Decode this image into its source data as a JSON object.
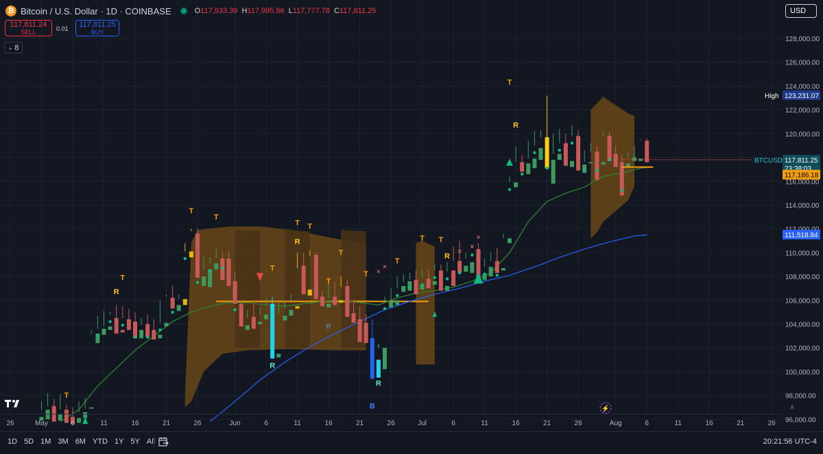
{
  "header": {
    "title": "Bitcoin / U.S. Dollar · 1D · COINBASE",
    "ohlc": [
      {
        "k": "O",
        "v": "117,933.39"
      },
      {
        "k": "H",
        "v": "117,995.86"
      },
      {
        "k": "L",
        "v": "117,777.78"
      },
      {
        "k": "C",
        "v": "117,811.25"
      }
    ]
  },
  "trade": {
    "sell_price": "117,811.24",
    "sell_label": "SELL",
    "buy_price": "117,811.25",
    "buy_label": "BUY",
    "spread": "0.01"
  },
  "indicator_badge": "8",
  "currency": "USD",
  "timeframes": [
    "1D",
    "5D",
    "1M",
    "3M",
    "6M",
    "YTD",
    "1Y",
    "5Y",
    "All"
  ],
  "clock": "20:21:56 UTC-4",
  "colors": {
    "up": "#26a69a",
    "down": "#ef5350",
    "up_wick": "#4caf50",
    "signal_up": "#facc15",
    "signal_down": "#f97316",
    "cloud": "#8a5a12",
    "ma_green": "#2e7d32",
    "ma_blue": "#2962ff",
    "dots": "#00e676"
  },
  "chart_data": {
    "type": "candlestick",
    "title": "Bitcoin / U.S. Dollar · 1D · COINBASE",
    "xlabel": "",
    "ylabel": "",
    "ylim": [
      95500,
      129500
    ],
    "y_ticks": [
      96000,
      98000,
      100000,
      102000,
      104000,
      106000,
      108000,
      110000,
      112000,
      114000,
      116000,
      118000,
      120000,
      122000,
      124000,
      126000,
      128000
    ],
    "x_ticks": [
      {
        "label": "26",
        "day": 0
      },
      {
        "label": "May",
        "day": 5
      },
      {
        "label": "6",
        "day": 10
      },
      {
        "label": "11",
        "day": 15
      },
      {
        "label": "16",
        "day": 20
      },
      {
        "label": "21",
        "day": 25
      },
      {
        "label": "26",
        "day": 30
      },
      {
        "label": "Jun",
        "day": 36
      },
      {
        "label": "6",
        "day": 41
      },
      {
        "label": "11",
        "day": 46
      },
      {
        "label": "16",
        "day": 51
      },
      {
        "label": "21",
        "day": 56
      },
      {
        "label": "26",
        "day": 61
      },
      {
        "label": "Jul",
        "day": 66
      },
      {
        "label": "6",
        "day": 71
      },
      {
        "label": "11",
        "day": 76
      },
      {
        "label": "16",
        "day": 81
      },
      {
        "label": "21",
        "day": 86
      },
      {
        "label": "26",
        "day": 91
      },
      {
        "label": "Aug",
        "day": 97
      },
      {
        "label": "6",
        "day": 102
      },
      {
        "label": "11",
        "day": 107
      },
      {
        "label": "16",
        "day": 112
      },
      {
        "label": "21",
        "day": 117
      },
      {
        "label": "26",
        "day": 122
      }
    ],
    "candles": [
      [
        5,
        96200,
        97500,
        96800,
        95900,
        "u"
      ],
      [
        6,
        96800,
        98200,
        97100,
        96000,
        "u"
      ],
      [
        7,
        97100,
        97700,
        96400,
        95800,
        "d"
      ],
      [
        8,
        96400,
        98100,
        96800,
        95900,
        "u"
      ],
      [
        9,
        96800,
        97200,
        96200,
        95700,
        "d"
      ],
      [
        10,
        96200,
        97000,
        96100,
        95600,
        "d"
      ],
      [
        11,
        96100,
        97500,
        96600,
        95700,
        "u"
      ],
      [
        12,
        96600,
        97800,
        96900,
        96100,
        "u"
      ],
      [
        13,
        97000,
        103500,
        103200,
        96900,
        "u"
      ],
      [
        14,
        103200,
        104700,
        103600,
        102400,
        "u"
      ],
      [
        15,
        103600,
        105100,
        103800,
        103100,
        "u"
      ],
      [
        16,
        103800,
        105000,
        104800,
        103500,
        "u"
      ],
      [
        17,
        104500,
        105600,
        103500,
        103200,
        "d"
      ],
      [
        18,
        103500,
        105500,
        104500,
        103300,
        "d"
      ],
      [
        19,
        104400,
        105300,
        104000,
        103500,
        "d"
      ],
      [
        20,
        104200,
        105000,
        103500,
        102800,
        "d"
      ],
      [
        21,
        103500,
        104500,
        103900,
        102800,
        "u"
      ],
      [
        22,
        104000,
        104800,
        103500,
        102900,
        "d"
      ],
      [
        23,
        103500,
        104400,
        103100,
        102700,
        "d"
      ],
      [
        24,
        103100,
        106000,
        104100,
        102800,
        "u"
      ],
      [
        25,
        104100,
        106500,
        106300,
        103800,
        "u"
      ],
      [
        26,
        106200,
        107200,
        105600,
        105300,
        "d"
      ],
      [
        27,
        105600,
        106500,
        106100,
        105100,
        "u"
      ],
      [
        28,
        106100,
        110800,
        110100,
        105600,
        "u"
      ],
      [
        29,
        110100,
        112000,
        111800,
        109600,
        "u"
      ],
      [
        30,
        111600,
        112000,
        108100,
        107900,
        "d"
      ],
      [
        31,
        108000,
        109700,
        108600,
        107200,
        "u"
      ],
      [
        32,
        108600,
        109600,
        109100,
        107100,
        "u"
      ],
      [
        33,
        109100,
        110400,
        109600,
        108600,
        "u"
      ],
      [
        34,
        109500,
        110100,
        109300,
        107700,
        "d"
      ],
      [
        35,
        109500,
        110100,
        107500,
        107200,
        "d"
      ],
      [
        36,
        107600,
        108400,
        105800,
        105700,
        "d"
      ],
      [
        37,
        105700,
        105900,
        104000,
        103800,
        "d"
      ],
      [
        38,
        103900,
        105200,
        104500,
        103500,
        "u"
      ],
      [
        39,
        104600,
        105700,
        104200,
        103600,
        "d"
      ],
      [
        40,
        104200,
        105400,
        104800,
        104000,
        "u"
      ],
      [
        41,
        104800,
        106200,
        105600,
        104400,
        "u"
      ],
      [
        42,
        105700,
        106300,
        101300,
        101100,
        "d"
      ],
      [
        43,
        101500,
        105800,
        104900,
        101200,
        "u"
      ],
      [
        44,
        104700,
        106000,
        105300,
        104300,
        "u"
      ],
      [
        45,
        105200,
        106500,
        105800,
        104700,
        "u"
      ],
      [
        46,
        105500,
        110000,
        108700,
        105300,
        "u"
      ],
      [
        47,
        108900,
        110000,
        106900,
        106500,
        "d"
      ],
      [
        48,
        106900,
        110200,
        109700,
        106400,
        "u"
      ],
      [
        49,
        109800,
        110000,
        106300,
        106100,
        "d"
      ],
      [
        50,
        106300,
        106800,
        105700,
        105500,
        "d"
      ],
      [
        51,
        105700,
        107400,
        106200,
        105400,
        "u"
      ],
      [
        52,
        106300,
        107500,
        105800,
        105600,
        "d"
      ],
      [
        53,
        106000,
        108000,
        107100,
        105800,
        "u"
      ],
      [
        54,
        107200,
        107700,
        104800,
        104600,
        "d"
      ],
      [
        55,
        104900,
        106000,
        104300,
        104100,
        "d"
      ],
      [
        56,
        104400,
        105500,
        104000,
        102500,
        "d"
      ],
      [
        57,
        104100,
        104800,
        102700,
        102400,
        "d"
      ],
      [
        58,
        102800,
        104400,
        101000,
        99400,
        "d"
      ],
      [
        59,
        101000,
        102300,
        102000,
        99500,
        "u"
      ],
      [
        60,
        102000,
        106300,
        105900,
        100200,
        "u"
      ],
      [
        61,
        105900,
        107000,
        106000,
        105400,
        "u"
      ],
      [
        62,
        106000,
        108000,
        107000,
        105600,
        "u"
      ],
      [
        63,
        107200,
        108200,
        107500,
        106700,
        "u"
      ],
      [
        64,
        107600,
        108300,
        107700,
        106800,
        "u"
      ],
      [
        65,
        107700,
        108500,
        107300,
        106500,
        "d"
      ],
      [
        66,
        107300,
        108600,
        107900,
        106900,
        "u"
      ],
      [
        67,
        107800,
        108600,
        107600,
        107000,
        "d"
      ],
      [
        68,
        107600,
        109000,
        108500,
        107300,
        "u"
      ],
      [
        69,
        108500,
        109000,
        107200,
        106800,
        "d"
      ],
      [
        70,
        107200,
        109200,
        108400,
        106800,
        "u"
      ],
      [
        71,
        108500,
        110500,
        109300,
        107200,
        "d"
      ],
      [
        72,
        109300,
        111000,
        108900,
        108300,
        "d"
      ],
      [
        73,
        108900,
        110000,
        109500,
        108400,
        "u"
      ],
      [
        74,
        109200,
        110500,
        110400,
        108300,
        "u"
      ],
      [
        75,
        110300,
        110800,
        108200,
        107900,
        "d"
      ],
      [
        76,
        108200,
        109500,
        108800,
        107700,
        "u"
      ],
      [
        77,
        108800,
        110000,
        109300,
        108000,
        "u"
      ],
      [
        78,
        109300,
        110400,
        108700,
        108300,
        "d"
      ],
      [
        79,
        108700,
        111600,
        111200,
        108500,
        "u"
      ],
      [
        80,
        111200,
        116400,
        115900,
        110800,
        "u"
      ],
      [
        81,
        115900,
        118900,
        117600,
        115500,
        "u"
      ],
      [
        82,
        117600,
        118200,
        117200,
        116800,
        "d"
      ],
      [
        83,
        117500,
        119400,
        117900,
        116600,
        "u"
      ],
      [
        84,
        117900,
        120200,
        119000,
        117100,
        "u"
      ],
      [
        85,
        118800,
        120300,
        119700,
        117800,
        "u"
      ],
      [
        86,
        119700,
        123200,
        117700,
        117100,
        "d"
      ],
      [
        87,
        117800,
        120000,
        118300,
        115800,
        "u"
      ],
      [
        88,
        118300,
        120400,
        119200,
        117800,
        "u"
      ],
      [
        89,
        119200,
        120000,
        117800,
        117300,
        "d"
      ],
      [
        90,
        117700,
        120700,
        119800,
        117200,
        "u"
      ],
      [
        91,
        119800,
        120300,
        117400,
        116900,
        "d"
      ],
      [
        92,
        117400,
        118600,
        117600,
        116700,
        "u"
      ],
      [
        93,
        117600,
        119200,
        118500,
        117500,
        "u"
      ],
      [
        94,
        118500,
        119000,
        117500,
        116100,
        "d"
      ],
      [
        95,
        117600,
        120200,
        119800,
        117400,
        "u"
      ],
      [
        96,
        119800,
        120100,
        118400,
        117700,
        "d"
      ],
      [
        97,
        118300,
        119000,
        117600,
        117200,
        "d"
      ],
      [
        98,
        117600,
        118200,
        115800,
        114800,
        "d"
      ],
      [
        99,
        117500,
        118400,
        117900,
        117200,
        "u"
      ],
      [
        100,
        118000,
        119000,
        118000,
        117700,
        "u"
      ],
      [
        101,
        117900,
        119500,
        119400,
        117700,
        "u"
      ],
      [
        102,
        119400,
        119600,
        117800,
        117600,
        "d"
      ]
    ],
    "ma_green": [
      [
        8,
        95800
      ],
      [
        11,
        96800
      ],
      [
        14,
        98800
      ],
      [
        17,
        100300
      ],
      [
        20,
        101800
      ],
      [
        23,
        103000
      ],
      [
        26,
        104200
      ],
      [
        29,
        105000
      ],
      [
        32,
        105500
      ],
      [
        35,
        105800
      ],
      [
        38,
        105800
      ],
      [
        41,
        105600
      ],
      [
        44,
        105500
      ],
      [
        47,
        105700
      ],
      [
        50,
        105900
      ],
      [
        53,
        106000
      ],
      [
        56,
        105800
      ],
      [
        59,
        105600
      ],
      [
        62,
        106200
      ],
      [
        65,
        106600
      ],
      [
        68,
        106800
      ],
      [
        71,
        107100
      ],
      [
        74,
        107600
      ],
      [
        77,
        108300
      ],
      [
        80,
        110000
      ],
      [
        83,
        112600
      ],
      [
        86,
        114300
      ],
      [
        89,
        115000
      ],
      [
        92,
        115500
      ],
      [
        95,
        116400
      ],
      [
        98,
        116700
      ],
      [
        101,
        117100
      ],
      [
        103,
        117200
      ]
    ],
    "ma_blue": [
      [
        32,
        95800
      ],
      [
        36,
        97500
      ],
      [
        40,
        99300
      ],
      [
        44,
        100800
      ],
      [
        48,
        102100
      ],
      [
        52,
        103200
      ],
      [
        56,
        104200
      ],
      [
        60,
        105200
      ],
      [
        64,
        105900
      ],
      [
        68,
        106500
      ],
      [
        72,
        107000
      ],
      [
        76,
        107600
      ],
      [
        80,
        108100
      ],
      [
        84,
        108800
      ],
      [
        88,
        109600
      ],
      [
        92,
        110300
      ],
      [
        96,
        110900
      ],
      [
        100,
        111400
      ],
      [
        102,
        111500
      ]
    ],
    "labels": [
      {
        "text": "T",
        "day": 9,
        "y": 97800,
        "color": "#f59e0b"
      },
      {
        "text": "R",
        "day": 17,
        "y": 106500,
        "color": "#facc15"
      },
      {
        "text": "T",
        "day": 18,
        "y": 107700,
        "color": "#f59e0b"
      },
      {
        "text": "T",
        "day": 29,
        "y": 113300,
        "color": "#f59e0b"
      },
      {
        "text": "T",
        "day": 33,
        "y": 112800,
        "color": "#f59e0b"
      },
      {
        "text": "T",
        "day": 42,
        "y": 108500,
        "color": "#f59e0b"
      },
      {
        "text": "R",
        "day": 42,
        "y": 100300,
        "color": "#5eead4"
      },
      {
        "text": "T",
        "day": 46,
        "y": 112300,
        "color": "#f59e0b"
      },
      {
        "text": "R",
        "day": 46,
        "y": 110700,
        "color": "#facc15"
      },
      {
        "text": "T",
        "day": 48,
        "y": 112000,
        "color": "#f59e0b"
      },
      {
        "text": "T",
        "day": 51,
        "y": 107400,
        "color": "#f59e0b"
      },
      {
        "text": "R",
        "day": 51,
        "y": 103600,
        "color": "#64748b"
      },
      {
        "text": "T",
        "day": 53,
        "y": 109800,
        "color": "#f59e0b"
      },
      {
        "text": "T",
        "day": 57,
        "y": 108000,
        "color": "#f59e0b"
      },
      {
        "text": "R",
        "day": 59,
        "y": 98800,
        "color": "#5eead4"
      },
      {
        "text": "B",
        "day": 58,
        "y": 96900,
        "color": "#3b82f6"
      },
      {
        "text": "T",
        "day": 62,
        "y": 109100,
        "color": "#f59e0b"
      },
      {
        "text": "T",
        "day": 66,
        "y": 111000,
        "color": "#f59e0b"
      },
      {
        "text": "T",
        "day": 69,
        "y": 110900,
        "color": "#f59e0b"
      },
      {
        "text": "R",
        "day": 70,
        "y": 109500,
        "color": "#facc15"
      },
      {
        "text": "T",
        "day": 80,
        "y": 124100,
        "color": "#f59e0b"
      },
      {
        "text": "R",
        "day": 81,
        "y": 120500,
        "color": "#facc15"
      }
    ]
  }
}
